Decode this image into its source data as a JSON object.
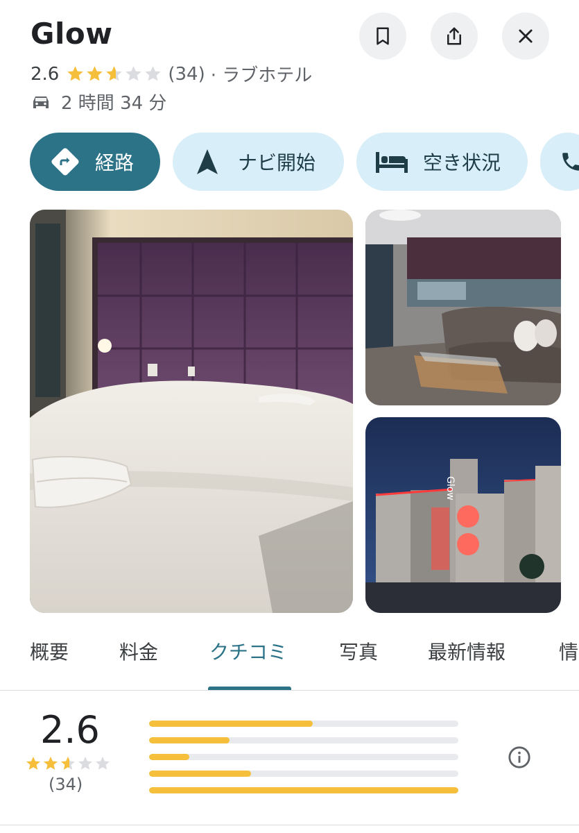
{
  "place": {
    "name": "Glow",
    "rating": "2.6",
    "rating_value": 2.6,
    "review_count": "(34)",
    "category": "· ラブホテル",
    "drive_time": "2 時間 34 分"
  },
  "actions": {
    "directions": "経路",
    "start_navigation": "ナビ開始",
    "availability": "空き状況"
  },
  "header_buttons": {
    "save_icon": "bookmark-icon",
    "share_icon": "share-icon",
    "close_icon": "close-icon"
  },
  "tabs": [
    {
      "label": "概要",
      "active": false
    },
    {
      "label": "料金",
      "active": false
    },
    {
      "label": "クチコミ",
      "active": true
    },
    {
      "label": "写真",
      "active": false
    },
    {
      "label": "最新情報",
      "active": false
    },
    {
      "label": "情",
      "active": false
    }
  ],
  "reviews_summary": {
    "rating": "2.6",
    "count": "(34)",
    "distribution": [
      {
        "stars": 5,
        "fraction": 0.53
      },
      {
        "stars": 4,
        "fraction": 0.26
      },
      {
        "stars": 3,
        "fraction": 0.13
      },
      {
        "stars": 2,
        "fraction": 0.33
      },
      {
        "stars": 1,
        "fraction": 1.0
      }
    ]
  },
  "colors": {
    "accent": "#2c7388",
    "chip_light": "#d8eef8",
    "star": "#f6bf3b",
    "star_empty": "#dadce0"
  }
}
